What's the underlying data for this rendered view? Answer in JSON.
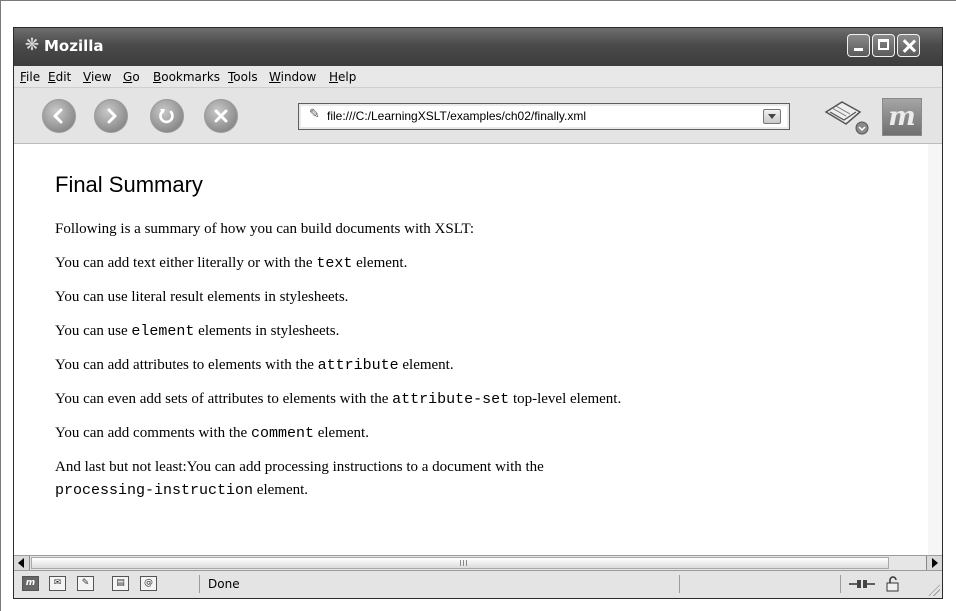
{
  "window": {
    "title": "Mozilla",
    "icon": "mozilla-app-icon"
  },
  "menubar": [
    {
      "label": "File",
      "accel": "F",
      "rest": "ile"
    },
    {
      "label": "Edit",
      "accel": "E",
      "rest": "dit"
    },
    {
      "label": "View",
      "accel": "V",
      "rest": "iew"
    },
    {
      "label": "Go",
      "accel": "G",
      "rest": "o"
    },
    {
      "label": "Bookmarks",
      "accel": "B",
      "rest": "ookmarks"
    },
    {
      "label": "Tools",
      "accel": "T",
      "rest": "ools"
    },
    {
      "label": "Window",
      "accel": "W",
      "rest": "indow"
    },
    {
      "label": "Help",
      "accel": "H",
      "rest": "elp"
    }
  ],
  "navbar": {
    "buttons": [
      "back-icon",
      "forward-icon",
      "reload-icon",
      "stop-icon"
    ],
    "url": "file:///C:/LearningXSLT/examples/ch02/finally.xml",
    "logo_text": "m"
  },
  "page": {
    "heading": "Final Summary",
    "intro": "Following is a summary of how you can build documents with XSLT:",
    "items": [
      {
        "pre": "You can add text either literally or with the ",
        "code": "text",
        "post": " element."
      },
      {
        "pre": "You can use literal result elements in stylesheets.",
        "code": "",
        "post": ""
      },
      {
        "pre": "You can use ",
        "code": "element",
        "post": " elements in stylesheets."
      },
      {
        "pre": "You can add attributes to elements with the ",
        "code": "attribute",
        "post": " element."
      },
      {
        "pre": "You can even add sets of attributes to elements with the ",
        "code": "attribute-set",
        "post": " top-level element."
      },
      {
        "pre": "You can add comments with the ",
        "code": "comment",
        "post": " element."
      }
    ],
    "last_line1": "And last but not least:You can add processing instructions to a document with the",
    "last_code": "processing-instruction",
    "last_post": " element."
  },
  "statusbar": {
    "icons": [
      "navigator-icon",
      "mail-icon",
      "composer-icon",
      "address-book-icon",
      "chat-icon"
    ],
    "text": "Done"
  }
}
